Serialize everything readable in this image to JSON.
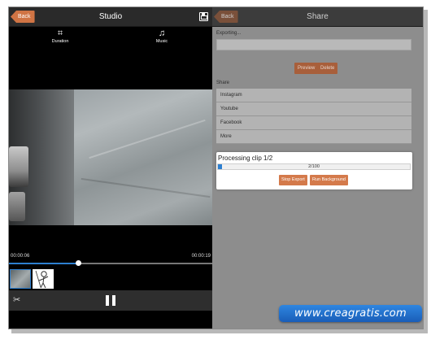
{
  "studio": {
    "back_label": "Back",
    "title": "Studio",
    "save_icon": "save-icon",
    "tools": [
      {
        "label": "Duration",
        "icon": "crop-icon",
        "glyph": "⌗"
      },
      {
        "label": "Music",
        "icon": "music-icon",
        "glyph": "♫"
      }
    ],
    "time_current": "00:00:06",
    "time_total": "00:00:19",
    "playback_fraction": 0.34,
    "controls": {
      "effects_icon": "effects-icon",
      "play_state_icon": "pause-icon"
    }
  },
  "share": {
    "back_label": "Back",
    "title": "Share",
    "exporting_label": "Exporting...",
    "preview_label": "Preview",
    "delete_label": "Delete",
    "share_label": "Share",
    "targets": [
      "Instagram",
      "Youtube",
      "Facebook",
      "More"
    ],
    "dialog": {
      "title": "Processing clip 1/2",
      "progress_text": "2/100",
      "progress_fraction": 0.02,
      "stop_label": "Stop Export",
      "background_label": "Run Background"
    }
  },
  "watermark": "www.creagratis.com",
  "colors": {
    "accent": "#d47a4b",
    "progress": "#2d7fd0",
    "watermark": "#2f86e0"
  }
}
